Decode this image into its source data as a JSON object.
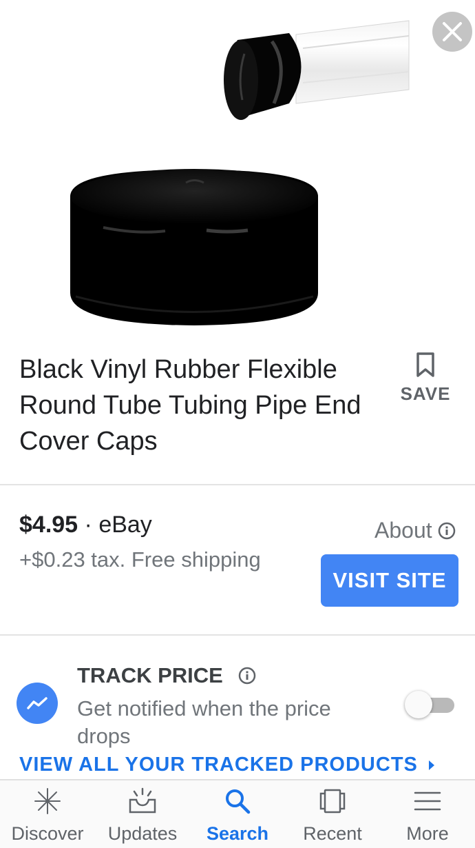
{
  "product": {
    "title": "Black Vinyl Rubber Flexible Round Tube Tubing Pipe End Cover Caps",
    "save_label": "SAVE"
  },
  "offer": {
    "price": "$4.95",
    "separator": " · ",
    "seller": "eBay",
    "tax_shipping": "+$0.23 tax. Free shipping",
    "about_label": "About",
    "visit_label": "VISIT SITE"
  },
  "tracking": {
    "title": "TRACK PRICE",
    "description": "Get notified when the price drops",
    "toggle_on": false,
    "view_all_label": "VIEW ALL YOUR TRACKED PRODUCTS"
  },
  "nav": {
    "items": [
      {
        "label": "Discover",
        "icon": "discover-icon"
      },
      {
        "label": "Updates",
        "icon": "updates-icon"
      },
      {
        "label": "Search",
        "icon": "search-icon"
      },
      {
        "label": "Recent",
        "icon": "recent-icon"
      },
      {
        "label": "More",
        "icon": "menu-icon"
      }
    ],
    "active": "Search"
  },
  "colors": {
    "accent": "#4285f4",
    "link": "#1a73e8",
    "text": "#202124",
    "muted": "#70757a"
  }
}
